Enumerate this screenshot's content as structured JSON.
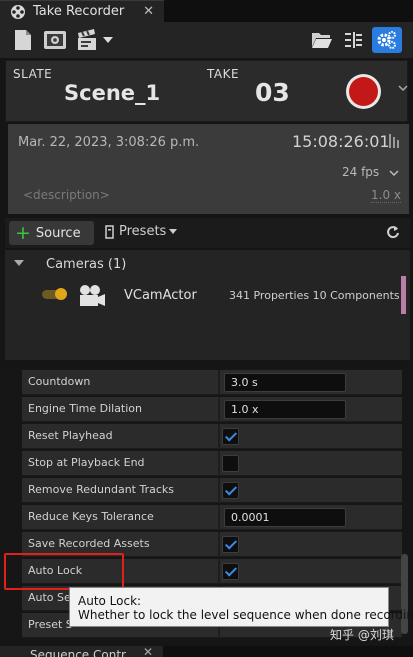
{
  "tab": {
    "title": "Take Recorder",
    "close": "✕",
    "icon": "film-reel-icon"
  },
  "toolbar": {
    "icons": [
      "new-document-icon",
      "review-icon",
      "clapperboard-icon",
      "dropdown-arrow-icon",
      "open-folder-icon",
      "list-settings-icon",
      "settings-gear-icon"
    ],
    "active_icon": "settings-gear-icon"
  },
  "slate": {
    "slate_label": "SLATE",
    "take_label": "TAKE",
    "slate_value": "Scene_1",
    "take_value": "03",
    "record_color": "#c41818"
  },
  "info": {
    "date": "Mar. 22, 2023, 3:08:26 p.m.",
    "timecode": "15:08:26:01",
    "fps": "24 fps",
    "description_placeholder": "<description>",
    "speed": "1.0 x"
  },
  "source_bar": {
    "source_label": "Source",
    "presets_label": "Presets"
  },
  "sources": {
    "group": "Cameras (1)",
    "actor": "VCamActor",
    "details": "341 Properties 10 Components"
  },
  "properties": [
    {
      "label": "Countdown",
      "type": "text",
      "value": "3.0 s"
    },
    {
      "label": "Engine Time Dilation",
      "type": "text",
      "value": "1.0 x"
    },
    {
      "label": "Reset Playhead",
      "type": "check",
      "checked": true
    },
    {
      "label": "Stop at Playback End",
      "type": "check",
      "checked": false
    },
    {
      "label": "Remove Redundant Tracks",
      "type": "check",
      "checked": true
    },
    {
      "label": "Reduce Keys Tolerance",
      "type": "text",
      "value": "0.0001"
    },
    {
      "label": "Save Recorded Assets",
      "type": "check",
      "checked": true
    },
    {
      "label": "Auto Lock",
      "type": "check",
      "checked": true
    },
    {
      "label": "Auto Se",
      "type": "check",
      "checked": false
    },
    {
      "label": "Preset S",
      "type": "check",
      "checked": false
    }
  ],
  "tooltip": {
    "title": "Auto Lock:",
    "body": "Whether to lock the level sequence when done recording"
  },
  "watermark": "知乎 @刘琪",
  "bottom_tab": {
    "title": "Sequence Contr",
    "close": "✕"
  },
  "highlight_color": "#e0201a"
}
